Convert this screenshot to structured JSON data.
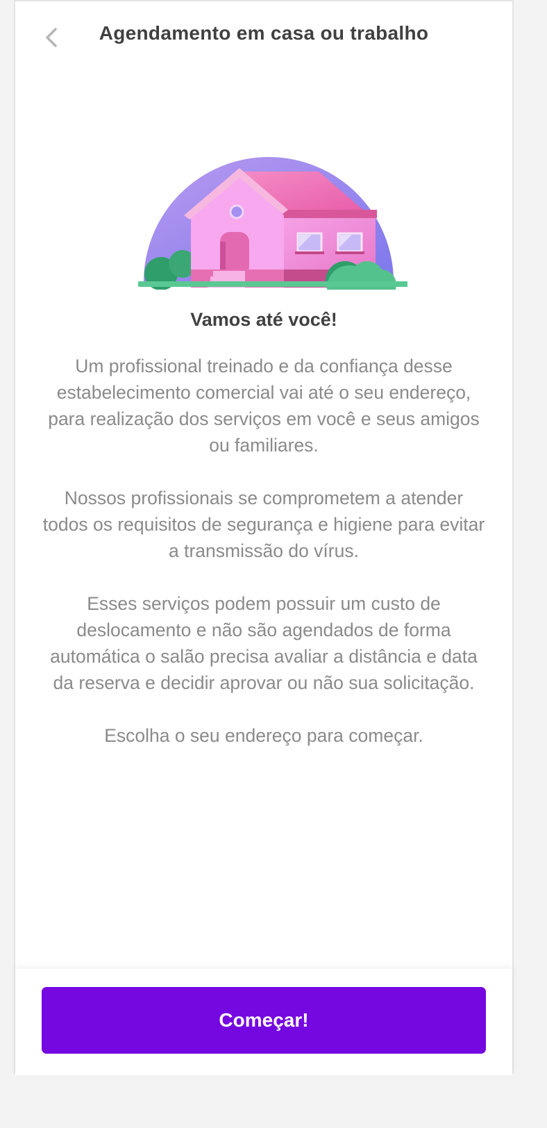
{
  "header": {
    "title": "Agendamento em casa ou trabalho",
    "back_icon": "chevron-left-icon"
  },
  "illustration": {
    "name": "house-illustration"
  },
  "content": {
    "heading": "Vamos até você!",
    "paragraphs": [
      "Um profissional treinado e da confiança desse estabelecimento comercial vai até o seu endereço, para realização dos serviços em você e seus amigos ou familiares.",
      "Nossos profissionais se comprometem a atender todos os requisitos de segurança e higiene para evitar a transmissão do vírus.",
      "Esses serviços podem possuir um custo de deslocamento e não são agendados de forma automática o salão precisa avaliar a distância e data da reserva e decidir aprovar ou não sua solicitação.",
      "Escolha o seu endereço para começar."
    ]
  },
  "footer": {
    "button_label": "Começar!",
    "button_color": "#7508e0"
  }
}
